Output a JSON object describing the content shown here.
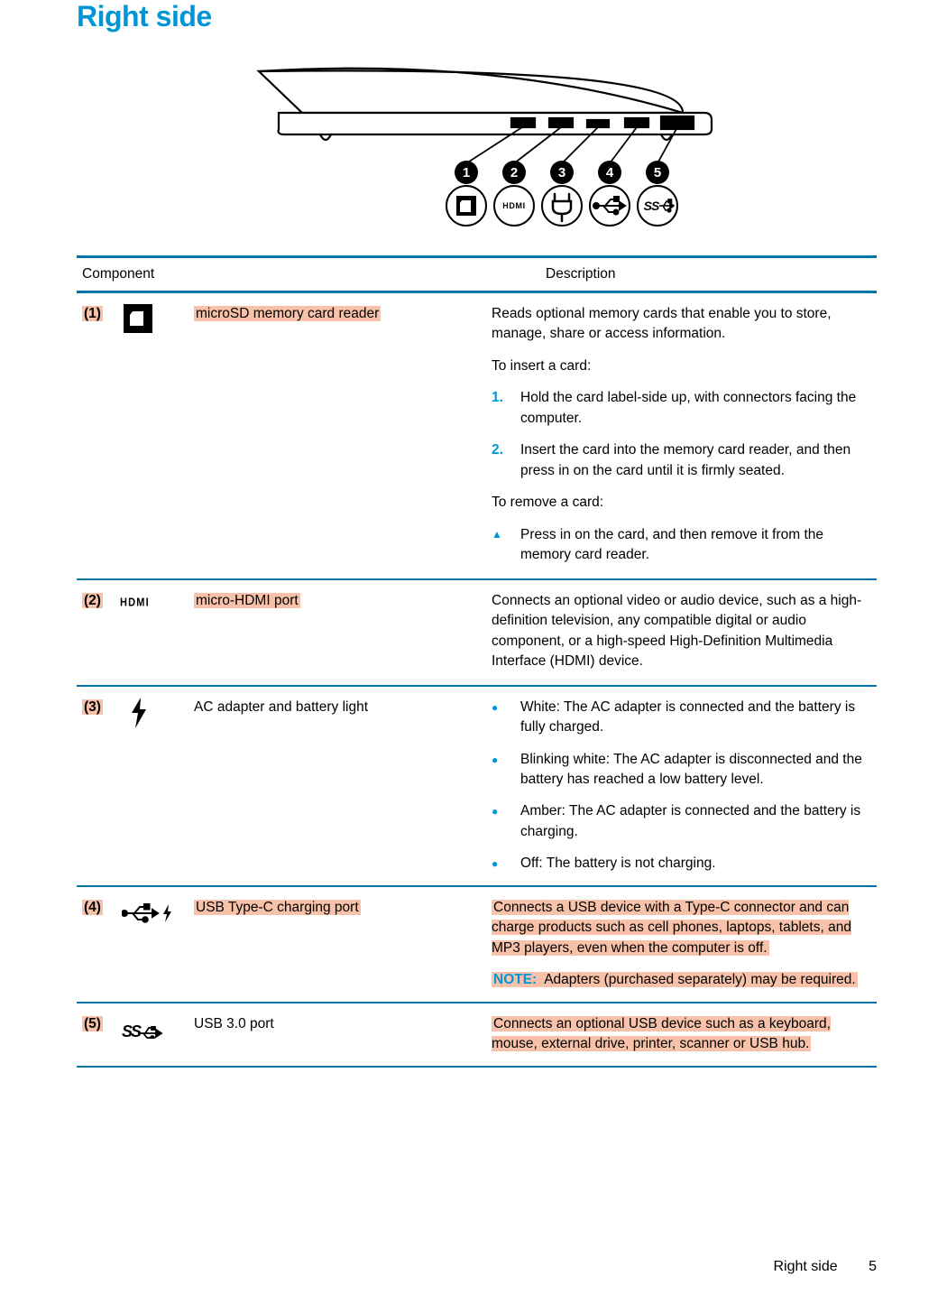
{
  "title": "Right side",
  "header": {
    "component": "Component",
    "description": "Description"
  },
  "rows": [
    {
      "idx": "(1)",
      "name": "microSD memory card reader",
      "intro": "Reads optional memory cards that enable you to store, manage, share or access information.",
      "insert_label": "To insert a card:",
      "steps": [
        "Hold the card label-side up, with connectors facing the computer.",
        "Insert the card into the memory card reader, and then press in on the card until it is firmly seated."
      ],
      "remove_label": "To remove a card:",
      "remove_step": "Press in on the card, and then remove it from the memory card reader."
    },
    {
      "idx": "(2)",
      "name": "micro-HDMI port",
      "desc": "Connects an optional video or audio device, such as a high-definition television, any compatible digital or audio component, or a high-speed High-Definition Multimedia Interface (HDMI) device."
    },
    {
      "idx": "(3)",
      "name": "AC adapter and battery light",
      "bullets": [
        "White: The AC adapter is connected and the battery is fully charged.",
        "Blinking white: The AC adapter is disconnected and the battery has reached a low battery level.",
        "Amber: The AC adapter is connected and the battery is charging.",
        "Off: The battery is not charging."
      ]
    },
    {
      "idx": "(4)",
      "name": "USB Type-C charging port",
      "desc": "Connects a USB device with a Type-C connector and can charge products such as cell phones, laptops, tablets, and MP3 players, even when the computer is off.",
      "note_label": "NOTE:",
      "note": "Adapters (purchased separately) may be required."
    },
    {
      "idx": "(5)",
      "name": "USB 3.0 port",
      "desc": "Connects an optional USB device such as a keyboard, mouse, external drive, printer, scanner or USB hub."
    }
  ],
  "footer": {
    "section": "Right side",
    "page": "5"
  },
  "icon_text": {
    "hdmi": "HDMI",
    "ss": "SS"
  }
}
